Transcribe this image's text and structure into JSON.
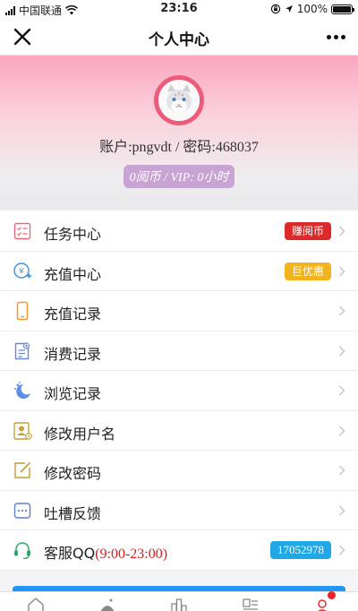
{
  "status_bar": {
    "carrier": "中国联通",
    "time": "23:16",
    "battery_percent": "100%",
    "battery_level": 1.0
  },
  "nav": {
    "title": "个人中心",
    "close_icon": "close-icon",
    "more_icon": "more-icon"
  },
  "profile": {
    "avatar_icon": "cat-avatar-icon",
    "account_text": "账户:pngvdt / 密码:468037",
    "coin_text": "0阅币 / VIP: 0小时"
  },
  "menu": {
    "items": [
      {
        "label": "任务中心",
        "icon": "task-icon",
        "badge": "赚阅币"
      },
      {
        "label": "充值中心",
        "icon": "recharge-icon",
        "badge": "巨优惠"
      },
      {
        "label": "充值记录",
        "icon": "phone-icon"
      },
      {
        "label": "消费记录",
        "icon": "bill-icon"
      },
      {
        "label": "浏览记录",
        "icon": "moon-icon"
      },
      {
        "label": "修改用户名",
        "icon": "user-card-icon"
      },
      {
        "label": "修改密码",
        "icon": "edit-icon"
      },
      {
        "label": "吐槽反馈",
        "icon": "chat-icon"
      },
      {
        "label_prefix": "客服QQ",
        "label_hours": "(9:00-23:00)",
        "icon": "headset-icon",
        "badge": "17052978"
      }
    ]
  },
  "tabs": [
    {
      "icon": "home-icon"
    },
    {
      "icon": "category-icon"
    },
    {
      "icon": "ranking-icon"
    },
    {
      "icon": "bookshelf-icon"
    },
    {
      "icon": "profile-icon"
    }
  ],
  "colors": {
    "accent_pink": "#ee5b7a",
    "badge_red": "#dc2a2a",
    "badge_yellow": "#f2b31e",
    "badge_blue": "#1fa7e6",
    "pill_purple": "#c9a3d3"
  }
}
